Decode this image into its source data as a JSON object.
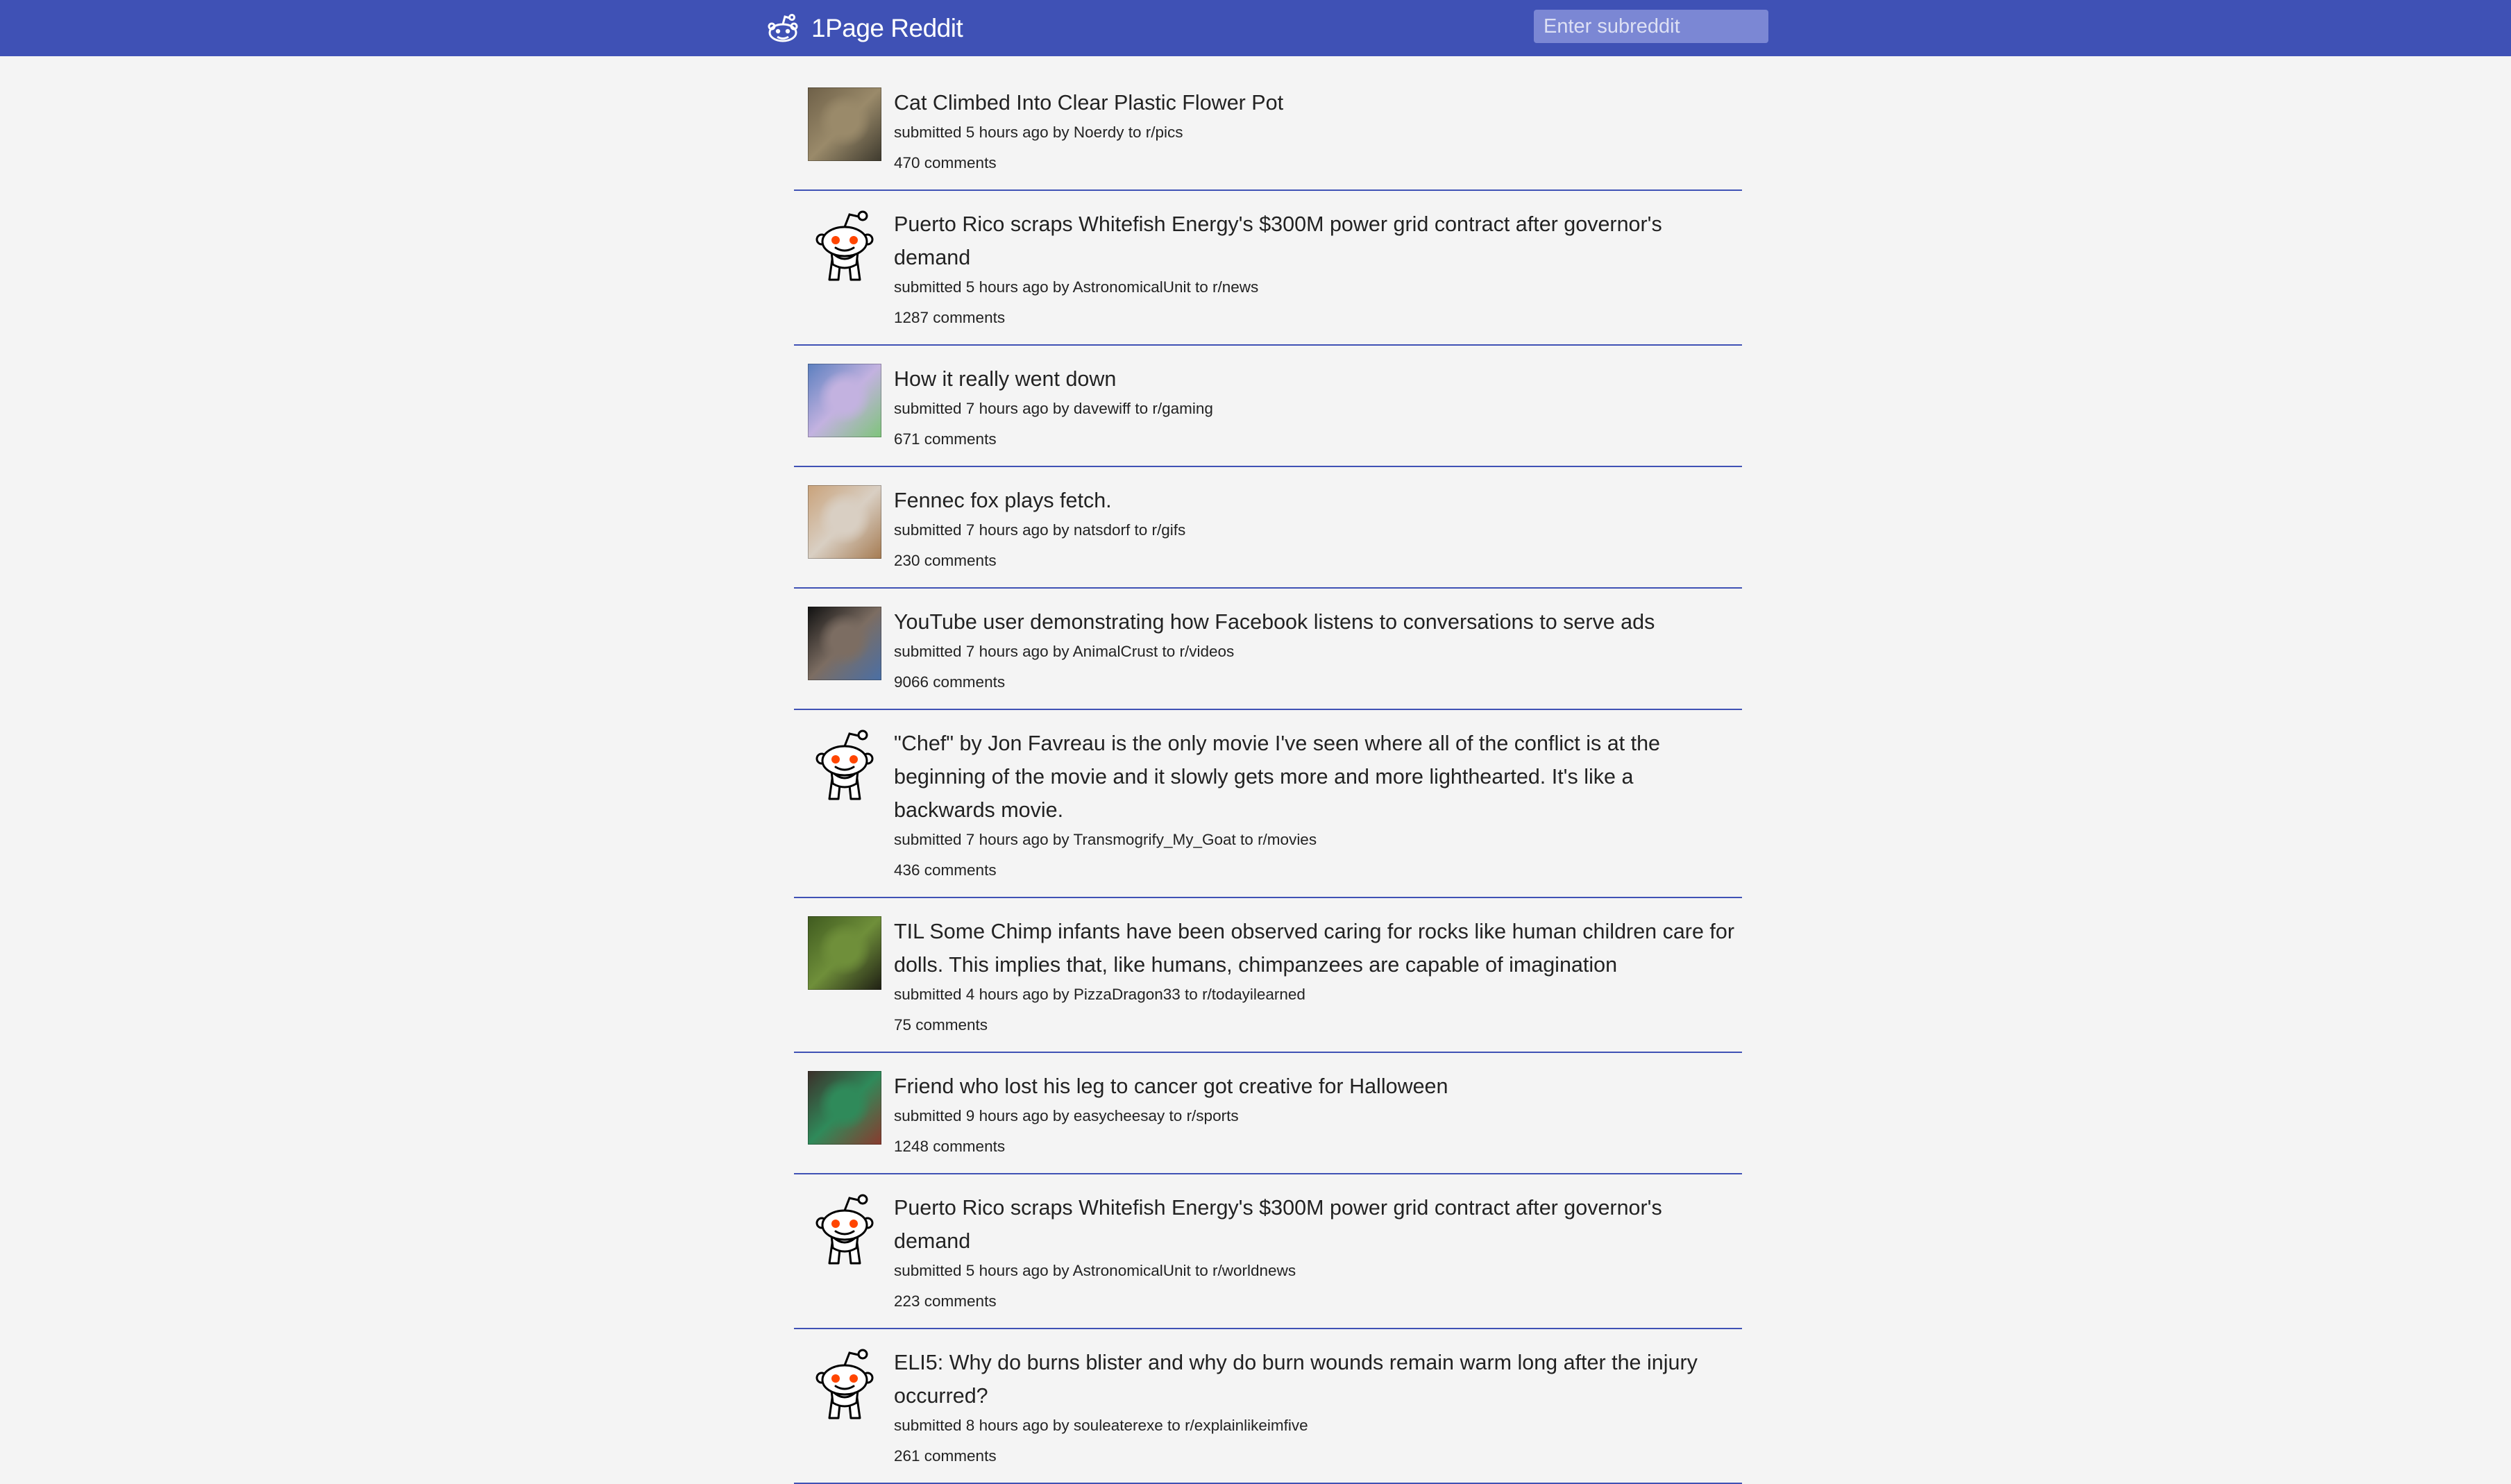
{
  "header": {
    "brand": "1Page Reddit",
    "search_placeholder": "Enter subreddit",
    "bar_color": "#3f51b5",
    "icon": "reddit-alien-icon"
  },
  "posts": [
    {
      "title": "Cat Climbed Into Clear Plastic Flower Pot",
      "meta_prefix": "submitted 5 hours ago by",
      "author": "Noerdy",
      "to": "to",
      "subreddit": "r/pics",
      "comments": "470 comments",
      "thumb": "image",
      "thumb_colors": [
        "#6e6048",
        "#9a8a6a",
        "#3e3a2e"
      ]
    },
    {
      "title": "Puerto Rico scraps Whitefish Energy's $300M power grid contract after governor's demand",
      "meta_prefix": "submitted 5 hours ago by",
      "author": "AstronomicalUnit",
      "to": "to",
      "subreddit": "r/news",
      "comments": "1287 comments",
      "thumb": "reddit-alien-icon"
    },
    {
      "title": "How it really went down",
      "meta_prefix": "submitted 7 hours ago by",
      "author": "davewiff",
      "to": "to",
      "subreddit": "r/gaming",
      "comments": "671 comments",
      "thumb": "image",
      "thumb_colors": [
        "#5b7fbf",
        "#c3b2e0",
        "#7ec47a"
      ]
    },
    {
      "title": "Fennec fox plays fetch.",
      "meta_prefix": "submitted 7 hours ago by",
      "author": "natsdorf",
      "to": "to",
      "subreddit": "r/gifs",
      "comments": "230 comments",
      "thumb": "image",
      "thumb_colors": [
        "#c9a27a",
        "#d9cfc3",
        "#a57b52"
      ]
    },
    {
      "title": "YouTube user demonstrating how Facebook listens to conversations to serve ads",
      "meta_prefix": "submitted 7 hours ago by",
      "author": "AnimalCrust",
      "to": "to",
      "subreddit": "r/videos",
      "comments": "9066 comments",
      "thumb": "image",
      "thumb_colors": [
        "#111111",
        "#7c6d62",
        "#4a6fa5"
      ]
    },
    {
      "title": "\"Chef\" by Jon Favreau is the only movie I've seen where all of the conflict is at the beginning of the movie and it slowly gets more and more lighthearted. It's like a backwards movie.",
      "meta_prefix": "submitted 7 hours ago by",
      "author": "Transmogrify_My_Goat",
      "to": "to",
      "subreddit": "r/movies",
      "comments": "436 comments",
      "thumb": "reddit-alien-icon"
    },
    {
      "title": "TIL Some Chimp infants have been observed caring for rocks like human children care for dolls. This implies that, like humans, chimpanzees are capable of imagination",
      "meta_prefix": "submitted 4 hours ago by",
      "author": "PizzaDragon33",
      "to": "to",
      "subreddit": "r/todayilearned",
      "comments": "75 comments",
      "thumb": "image",
      "thumb_colors": [
        "#3f5a1f",
        "#6f8f3a",
        "#1f1f14"
      ]
    },
    {
      "title": "Friend who lost his leg to cancer got creative for Halloween",
      "meta_prefix": "submitted 9 hours ago by",
      "author": "easycheesay",
      "to": "to",
      "subreddit": "r/sports",
      "comments": "1248 comments",
      "thumb": "image",
      "thumb_colors": [
        "#3c2f2a",
        "#2f8a5a",
        "#8a3a2e"
      ]
    },
    {
      "title": "Puerto Rico scraps Whitefish Energy's $300M power grid contract after governor's demand",
      "meta_prefix": "submitted 5 hours ago by",
      "author": "AstronomicalUnit",
      "to": "to",
      "subreddit": "r/worldnews",
      "comments": "223 comments",
      "thumb": "reddit-alien-icon"
    },
    {
      "title": "ELI5: Why do burns blister and why do burn wounds remain warm long after the injury occurred?",
      "meta_prefix": "submitted 8 hours ago by",
      "author": "souleaterexe",
      "to": "to",
      "subreddit": "r/explainlikeimfive",
      "comments": "261 comments",
      "thumb": "reddit-alien-icon"
    }
  ]
}
